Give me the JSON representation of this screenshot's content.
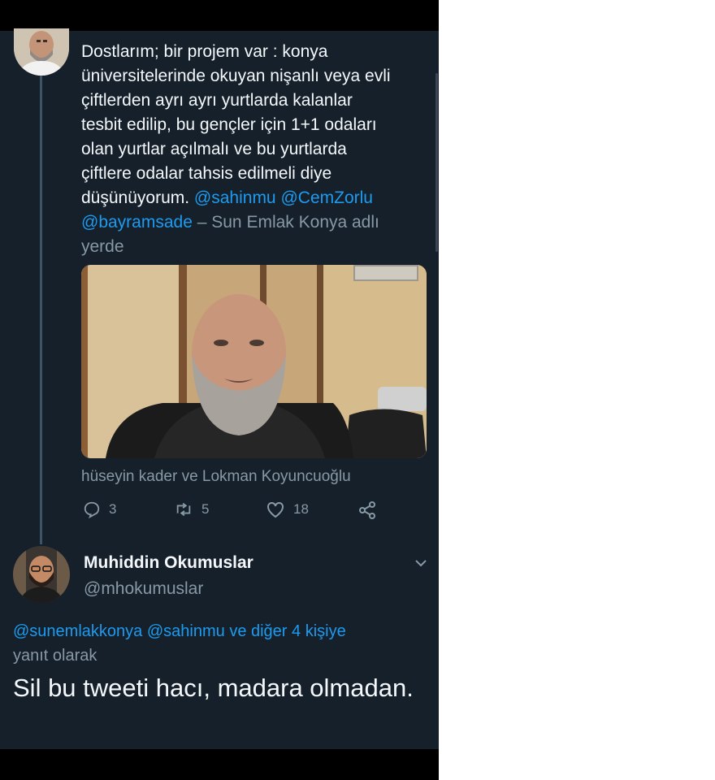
{
  "tweet": {
    "text_main": "Dostlarım; bir projem var : konya\nüniversitelerinde okuyan nişanlı veya evli\nçiftlerden ayrı ayrı yurtlarda kalanlar\ntesbit edilip, bu gençler için  1+1 odaları\nolan yurtlar açılmalı ve bu yurtlarda\nçiftlere odalar tahsis edilmeli diye\ndüşünüyorum. ",
    "mention_1": "@sahinmu",
    "mention_2": "@CemZorlu",
    "mention_3": "@bayramsade",
    "location_sep": " – ",
    "location_text": "Sun Emlak Konya adlı yerde",
    "photo_tags": "hüseyin kader ve Lokman Koyuncuoğlu",
    "reply_count": "3",
    "retweet_count": "5",
    "like_count": "18",
    "icons": {
      "reply": "reply-icon",
      "retweet": "retweet-icon",
      "like": "heart-icon",
      "share": "share-icon"
    }
  },
  "reply": {
    "name": "Muhiddin Okumuslar",
    "handle": "@mhokumuslar",
    "replying_to_mention_1": "@sunemlakkonya",
    "replying_to_mention_2": "@sahinmu",
    "replying_to_others": "ve diğer 4 kişiye",
    "replying_to_suffix": "yanıt olarak",
    "text": "Sil bu tweeti hacı, madara olmadan."
  },
  "colors": {
    "background": "#15202b",
    "text": "#f5f8fa",
    "secondary": "#8899a6",
    "accent": "#1d9bf0"
  }
}
